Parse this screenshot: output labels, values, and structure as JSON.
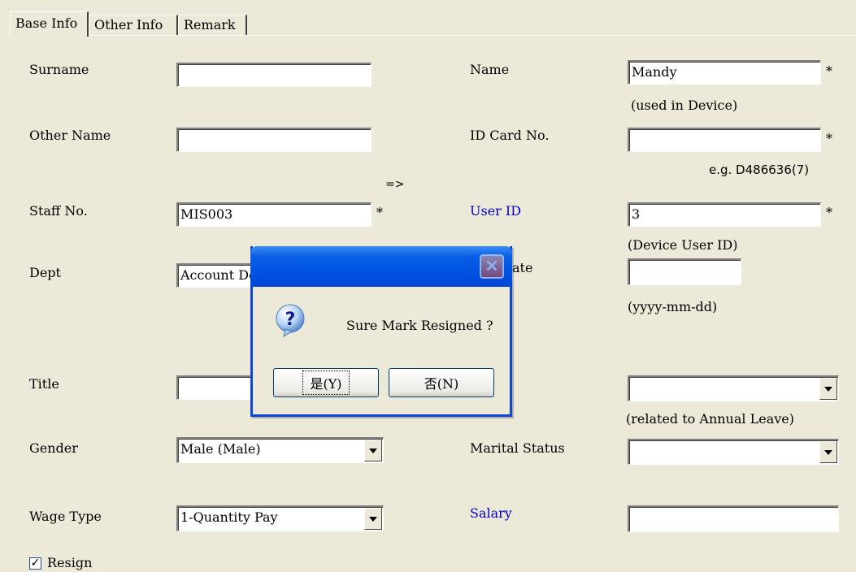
{
  "tabs": [
    "Base Info",
    "Other Info",
    "Remark"
  ],
  "form": {
    "surname_label": "Surname",
    "surname_value": "",
    "name_label": "Name",
    "name_value": "Mandy",
    "name_hint": "(used in Device)",
    "other_name_label": "Other Name",
    "other_name_value": "",
    "id_card_label": "ID Card No.",
    "id_card_value": "",
    "id_card_hint": "e.g. D486636(7)",
    "arrow_text": "=>",
    "staff_no_label": "Staff No.",
    "staff_no_value": "MIS003",
    "user_id_label": "User ID",
    "user_id_value": "3",
    "user_id_hint": "(Device User ID)",
    "dept_label": "Dept",
    "dept_value": "Account De",
    "date_label_partial": "ate",
    "date_value": "",
    "date_hint": "(yyyy-mm-dd)",
    "title_label": "Title",
    "title_value": "",
    "annual_combo_value": "",
    "annual_hint": "(related to Annual Leave)",
    "gender_label": "Gender",
    "gender_value": "Male (Male)",
    "marital_label": "Marital Status",
    "marital_value": "",
    "wage_type_label": "Wage Type",
    "wage_type_value": "1-Quantity Pay",
    "salary_label": "Salary",
    "salary_value": "",
    "resign_label": "Resign",
    "resign_checked": "✓",
    "required_mark": "*"
  },
  "dialog": {
    "message": "Sure Mark Resigned ?",
    "yes_label": "是(Y)",
    "no_label": "否(N)",
    "close_glyph": "×",
    "icon": "question-icon"
  },
  "colors": {
    "background": "#ece9d8",
    "link_blue": "#0000c8",
    "titlebar": "#0053e1"
  }
}
